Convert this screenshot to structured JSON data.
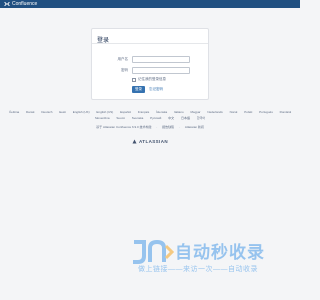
{
  "topbar": {
    "brand_icon": "confluence-x-icon",
    "brand_label": "Confluence",
    "background": "#205081"
  },
  "login": {
    "title": "登录",
    "username_label": "用户名",
    "username_value": "",
    "password_label": "密码",
    "password_value": "",
    "remember_label": "记住我的登录信息",
    "remember_checked": false,
    "login_button": "登录",
    "forgot_link": "忘记密码",
    "accent": "#3572b0"
  },
  "languages": [
    "Čeština",
    "Dansk",
    "Deutsch",
    "Eesti",
    "English (UK)",
    "English (US)",
    "Español",
    "Français",
    "Íslenska",
    "Italiano",
    "Magyar",
    "Nederlands",
    "Norsk",
    "Polski",
    "Português",
    "Română",
    "Slovenčina",
    "Suomi",
    "Svenska",
    "Русский",
    "中文",
    "日本語",
    "한국어"
  ],
  "footer": {
    "text": "基于 Atlassian Confluence 6.9.0 技术构建",
    "report_link": "报告缺陷",
    "news_link": "Atlassian 新闻"
  },
  "atlassian": {
    "icon": "atlassian-triangle-icon",
    "label": "ATLASSIAN"
  },
  "watermark": {
    "title": "自动秒收录",
    "subtitle": "做上链接——来访一次——自动收录"
  }
}
